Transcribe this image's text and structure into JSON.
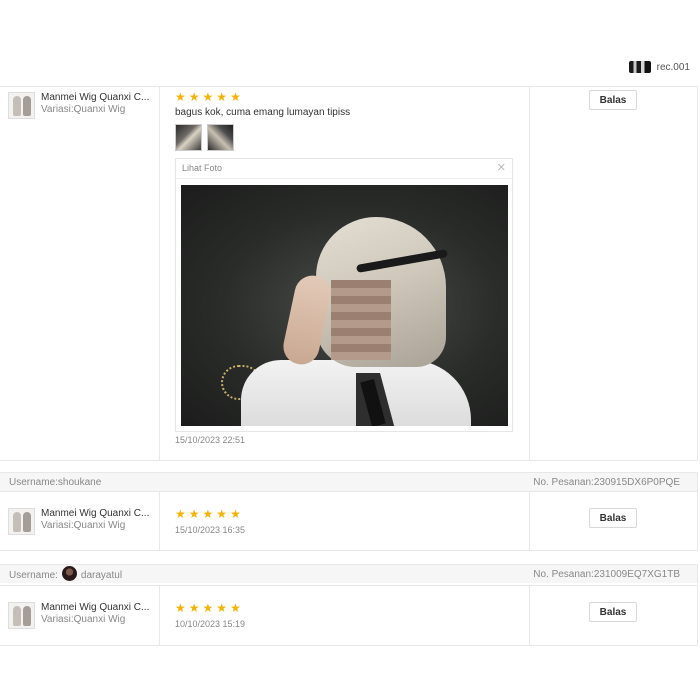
{
  "top_user": {
    "name": "rec.001"
  },
  "product": {
    "name": "Manmei Wig Quanxi C...",
    "variant": "Variasi:Quanxi Wig"
  },
  "reply_label": "Balas",
  "viewer": {
    "title": "Lihat Foto"
  },
  "reviews": [
    {
      "stars": 5,
      "comment": "bagus kok, cuma emang lumayan tipiss",
      "date": "15/10/2023 22:51"
    },
    {
      "username_label": "Username:shoukane",
      "order_label": "No. Pesanan:230915DX6P0PQE",
      "stars": 5,
      "date": "15/10/2023 16:35"
    },
    {
      "username_label": "Username:",
      "username": "darayatul",
      "order_label": "No. Pesanan:231009EQ7XG1TB",
      "stars": 5,
      "date": "10/10/2023 15:19"
    }
  ],
  "colors": {
    "star": "#f5b400",
    "border": "#e8e8e8",
    "header_bg": "#f6f6f6"
  }
}
